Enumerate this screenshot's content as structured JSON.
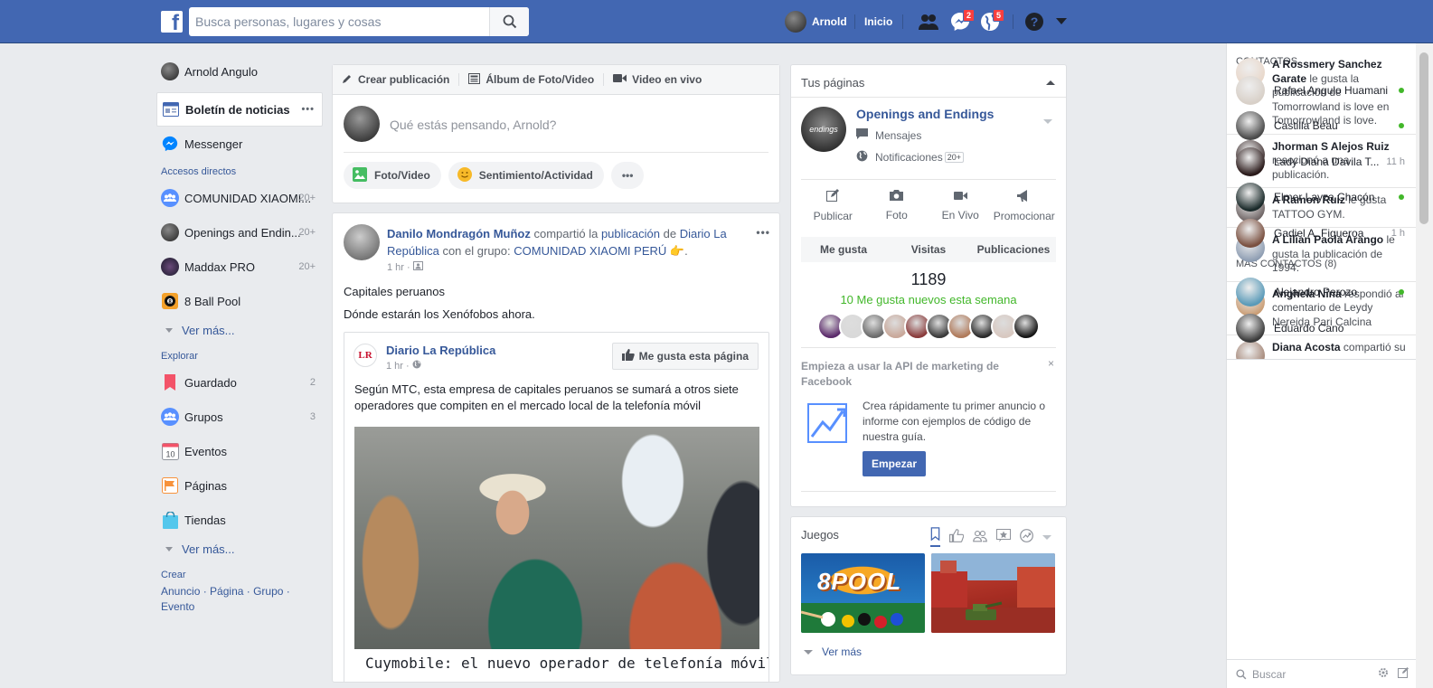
{
  "topbar": {
    "logo": "f",
    "search_placeholder": "Busca personas, lugares y cosas",
    "user_name": "Arnold",
    "home": "Inicio",
    "badge_messages": "2",
    "badge_notifications": "5"
  },
  "leftnav": {
    "profile": "Arnold Angulo",
    "items": [
      {
        "label": "Boletín de noticias",
        "icon": "news-feed-icon"
      },
      {
        "label": "Messenger",
        "icon": "messenger-icon"
      }
    ],
    "shortcuts_heading": "Accesos directos",
    "shortcuts": [
      {
        "label": "COMUNIDAD XIAOMI...",
        "count": "20+"
      },
      {
        "label": "Openings and Endin...",
        "count": "20+"
      },
      {
        "label": "Maddax PRO",
        "count": "20+"
      },
      {
        "label": "8 Ball Pool",
        "count": ""
      }
    ],
    "see_more_1": "Ver más...",
    "explore_heading": "Explorar",
    "explore": [
      {
        "label": "Guardado",
        "count": "2"
      },
      {
        "label": "Grupos",
        "count": "3"
      },
      {
        "label": "Eventos",
        "count": "",
        "day": "10"
      },
      {
        "label": "Páginas",
        "count": ""
      },
      {
        "label": "Tiendas",
        "count": ""
      }
    ],
    "see_more_2": "Ver más...",
    "create_heading": "Crear",
    "create_links": [
      "Anuncio",
      "Página",
      "Grupo",
      "Evento"
    ]
  },
  "composer": {
    "tabs": [
      "Crear publicación",
      "Álbum de Foto/Video",
      "Video en vivo"
    ],
    "prompt": "Qué estás pensando, Arnold?",
    "actions": [
      "Foto/Video",
      "Sentimiento/Actividad"
    ],
    "more": "•••"
  },
  "post": {
    "author": "Danilo Mondragón Muñoz",
    "shared": "compartió la",
    "publication": "publicación",
    "of": "de",
    "source": "Diario La República",
    "with_group": "con el grupo:",
    "group": "COMUNIDAD XIAOMI PERÚ",
    "emoji": "👉.",
    "time": "1 hr ·",
    "text_1": "Capitales peruanos",
    "text_2": "Dónde estarán los Xenófobos ahora.",
    "shared_page": "Diario La República",
    "shared_logo": "LR",
    "shared_time": "1 hr ·",
    "like_page": "Me gusta esta página",
    "shared_text": "Según MTC, esta empresa de capitales peruanos se sumará a otros siete operadores que compiten en el mercado local de la telefonía móvil",
    "headline": "Cuymobile: el nuevo operador de telefonía móvil en"
  },
  "pages": {
    "title": "Tus páginas",
    "page_name": "Openings and Endings",
    "page_avatar_text": "endings",
    "messages": "Mensajes",
    "notifications": "Notificaciones",
    "notif_badge": "20+",
    "actions": [
      "Publicar",
      "Foto",
      "En Vivo",
      "Promocionar"
    ],
    "tabs": [
      "Me gusta",
      "Visitas",
      "Publicaciones"
    ],
    "likes": "1189",
    "new_likes": "10 Me gusta nuevos esta semana",
    "face_colors": [
      "#5b2a6b",
      "#d9d9d9",
      "#6b6b6b",
      "#c9a89a",
      "#8a3b3b",
      "#3a3a3a",
      "#b07a5a",
      "#2a2a2a",
      "#d8c8c0",
      "#151515"
    ],
    "api_title": "Empieza a usar la API de marketing de Facebook",
    "api_text": "Crea rápidamente tu primer anuncio o informe con ejemplos de código de nuestra guía.",
    "api_button": "Empezar",
    "close": "×"
  },
  "games": {
    "title": "Juegos",
    "tile1": "8POOL",
    "see_more": "Ver más"
  },
  "ticker": [
    {
      "html_bold": "A Rossmery Sanchez Garate",
      "rest": " le gusta la publicación de Tomorrowland is love en Tomorrowland is love.",
      "color": "#e8d6c8"
    },
    {
      "html_bold": "Jhorman S Alejos Ruiz",
      "rest": " reaccionó a una publicación.",
      "color": "#3a2a2a"
    },
    {
      "html_bold": "A Ramon Ruiz",
      "rest": " le gusta TATTOO GYM.",
      "color": "#6a6060"
    },
    {
      "html_bold": "A Lilian Paola Arango",
      "rest": " le gusta la publicación de 1994.",
      "color": "#8a9ab0"
    },
    {
      "html_bold": "Anghela Nina",
      "rest": " respondió al comentario de Leydy Nereida Pari Calcina",
      "color": "#c89a70"
    },
    {
      "html_bold": "Diana Acosta",
      "rest": " compartió su",
      "color": "#a08070"
    }
  ],
  "contacts": {
    "heading": "CONTACTOS",
    "items": [
      {
        "name": "Rafael Angulo Huamani",
        "status": "online",
        "color": "#d8d0c8"
      },
      {
        "name": "Castilla Beau",
        "status": "online",
        "color": "#4a4a4a"
      },
      {
        "name": "Lady Diana Davila T...",
        "status": "11 h",
        "color": "#2a1a1a"
      },
      {
        "name": "Elmer Layza Chacón",
        "status": "online",
        "color": "#1a2a2a"
      },
      {
        "name": "Gadiel A. Figueroa",
        "status": "1 h",
        "color": "#7a5040"
      }
    ],
    "more_heading": "MÁS CONTACTOS (8)",
    "more": [
      {
        "name": "Alejandro Perozo",
        "status": "online",
        "color": "#5a9ab8"
      },
      {
        "name": "Eduardo Cano",
        "status": "",
        "color": "#3a3a3a"
      }
    ],
    "search_placeholder": "Buscar"
  }
}
